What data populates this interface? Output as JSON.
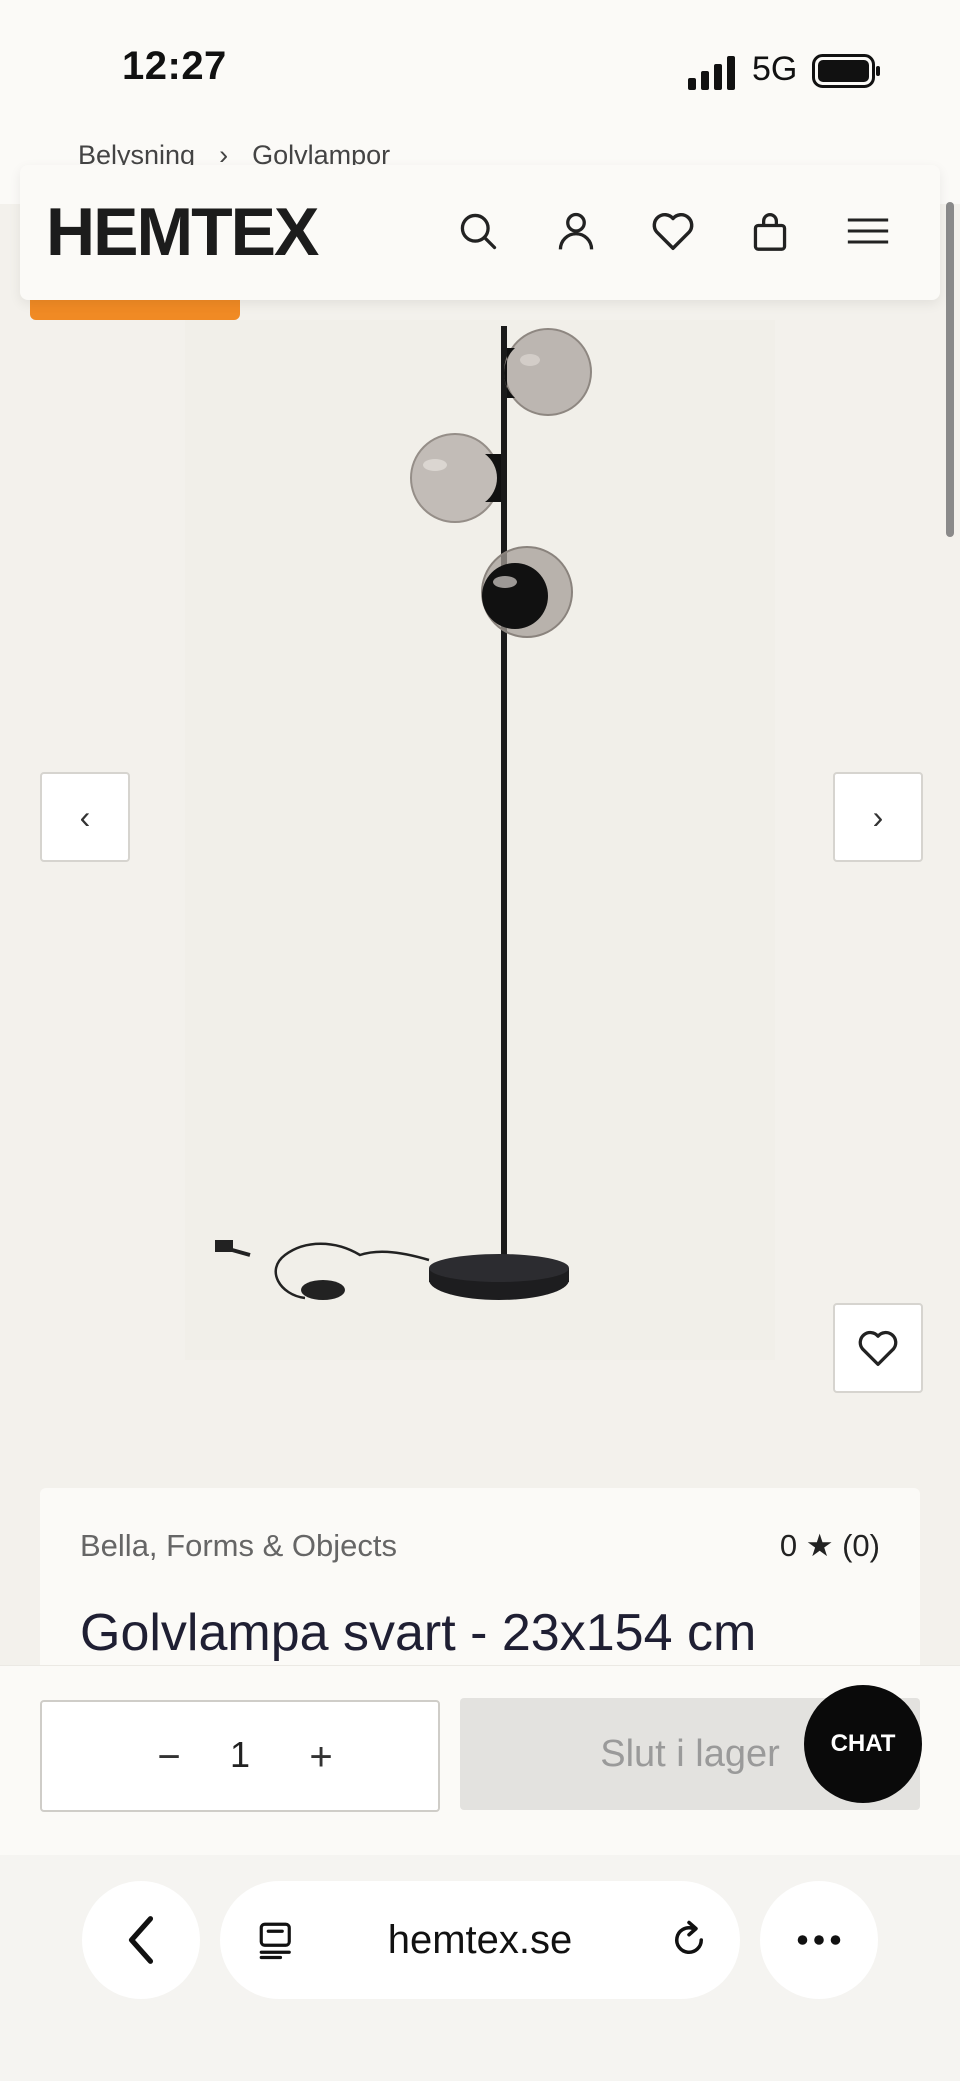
{
  "status": {
    "time": "12:27",
    "network": "5G"
  },
  "breadcrumb": [
    "Belysning",
    "Golvlampor"
  ],
  "header": {
    "logo": "HEMTEX",
    "icons": [
      "search-icon",
      "account-icon",
      "wishlist-icon",
      "cart-icon",
      "menu-icon"
    ]
  },
  "gallery": {
    "prev_label": "‹",
    "next_label": "›"
  },
  "product": {
    "brand": "Bella, Forms & Objects",
    "rating": "0 ★ (0)",
    "title": "Golvlampa svart - 23x154 cm"
  },
  "purchase": {
    "minus": "−",
    "quantity": "1",
    "plus": "+",
    "button_label": "Slut i lager"
  },
  "chat": {
    "label": "CHAT"
  },
  "browser": {
    "url": "hemtex.se"
  },
  "colors": {
    "accent": "#f08a24",
    "chat": "#0a0a0a",
    "disabled": "#e3e2df"
  }
}
